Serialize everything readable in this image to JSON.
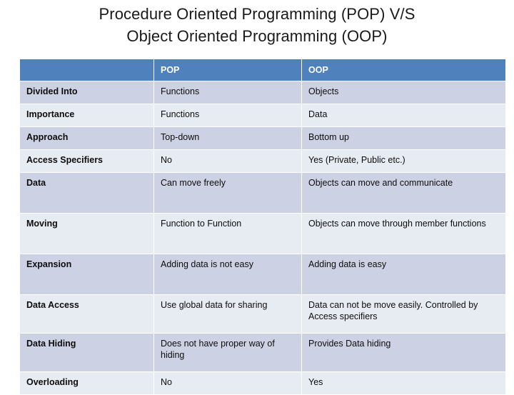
{
  "slide": {
    "title_line1": "Procedure Oriented Programming (POP) V/S",
    "title_line2": "Object Oriented Programming (OOP)"
  },
  "colors": {
    "header_blue": "#4f81bd",
    "band_dark": "#ccd2e3",
    "band_light": "#e7ebf2",
    "text": "#0d0d0d",
    "header_text": "#ffffff",
    "background": "#ffffff"
  },
  "table": {
    "headers": [
      "",
      "POP",
      "OOP"
    ],
    "rows": [
      {
        "label": "Divided Into",
        "pop": "Functions",
        "oop": "Objects"
      },
      {
        "label": "Importance",
        "pop": "Functions",
        "oop": "Data"
      },
      {
        "label": "Approach",
        "pop": "Top-down",
        "oop": "Bottom  up"
      },
      {
        "label": "Access Specifiers",
        "pop": "No",
        "oop": "Yes (Private, Public etc.)"
      },
      {
        "label": "Data",
        "pop": "Can move freely",
        "oop": "Objects can move and communicate"
      },
      {
        "label": "Moving",
        "pop": "Function to Function",
        "oop": "Objects can move through member functions"
      },
      {
        "label": "Expansion",
        "pop": "Adding data is not easy",
        "oop": "Adding data is easy"
      },
      {
        "label": "Data Access",
        "pop": "Use global data for sharing",
        "oop": "Data can not be move easily. Controlled by Access specifiers"
      },
      {
        "label": "Data Hiding",
        "pop": "Does not have proper way of hiding",
        "oop": "Provides Data hiding"
      },
      {
        "label": "Overloading",
        "pop": "No",
        "oop": "Yes"
      }
    ]
  }
}
